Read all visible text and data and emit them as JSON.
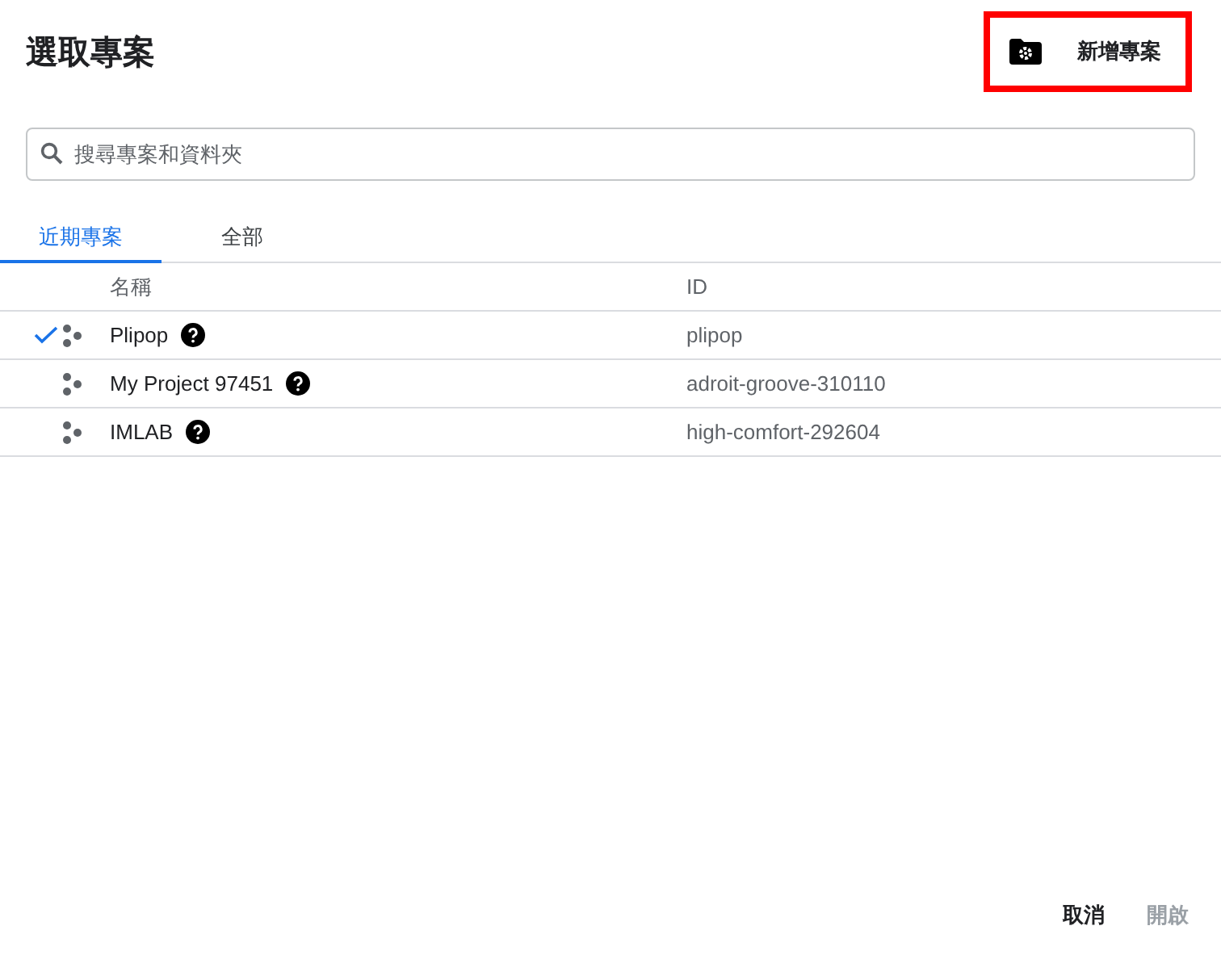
{
  "title": "選取專案",
  "new_project_button": {
    "label": "新增專案",
    "highlighted": true
  },
  "search": {
    "placeholder": "搜尋專案和資料夾"
  },
  "tabs": [
    {
      "label": "近期專案",
      "selected": true
    },
    {
      "label": "全部",
      "selected": false
    }
  ],
  "table": {
    "columns": [
      "名稱",
      "ID"
    ],
    "rows": [
      {
        "name": "Plipop",
        "id": "plipop",
        "selected": true
      },
      {
        "name": "My Project 97451",
        "id": "adroit-groove-310110",
        "selected": false
      },
      {
        "name": "IMLAB",
        "id": "high-comfort-292604",
        "selected": false
      }
    ]
  },
  "buttons": [
    {
      "label": "取消",
      "disabled": false
    },
    {
      "label": "開啟",
      "disabled": true
    }
  ]
}
